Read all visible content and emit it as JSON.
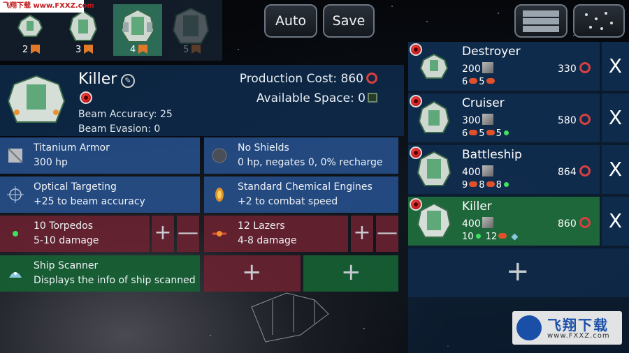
{
  "watermark": {
    "top_text": "飞翔下载 www.FXXZ.com",
    "bottom_cn": "飞翔下载",
    "bottom_url": "www.FXXZ.com"
  },
  "tray": {
    "slots": [
      {
        "num": "2"
      },
      {
        "num": "3"
      },
      {
        "num": "4"
      },
      {
        "num": "5"
      }
    ],
    "selected_index": 2
  },
  "toolbar": {
    "auto_label": "Auto",
    "save_label": "Save"
  },
  "ship": {
    "name": "Killer",
    "beam_accuracy": "Beam Accuracy: 25",
    "beam_evasion": "Beam Evasion: 0",
    "production_cost": "Production Cost: 860",
    "available_space": "Available Space: 0"
  },
  "modules": {
    "armor": {
      "title": "Titanium Armor",
      "desc": "300 hp"
    },
    "shields": {
      "title": "No Shields",
      "desc": "0 hp, negates 0, 0% recharge"
    },
    "targeting": {
      "title": "Optical Targeting",
      "desc": "+25 to beam accuracy"
    },
    "engines": {
      "title": "Standard Chemical Engines",
      "desc": "+2 to combat speed"
    },
    "torpedos": {
      "title": "10 Torpedos",
      "desc": "5-10 damage"
    },
    "lazers": {
      "title": "12 Lazers",
      "desc": "4-8 damage"
    },
    "scanner": {
      "title": "Ship Scanner",
      "desc": "Displays the info of ship scanned"
    }
  },
  "symbols": {
    "plus": "+",
    "minus": "—",
    "close": "X",
    "edit": "✎"
  },
  "designs": [
    {
      "name": "Destroyer",
      "hp": "200",
      "cost": "330",
      "w1": "6",
      "w2": "5",
      "w3": ""
    },
    {
      "name": "Cruiser",
      "hp": "300",
      "cost": "580",
      "w1": "6",
      "w2": "5",
      "w3": "5"
    },
    {
      "name": "Battleship",
      "hp": "400",
      "cost": "864",
      "w1": "9",
      "w2": "8",
      "w3": "8"
    },
    {
      "name": "Killer",
      "hp": "400",
      "cost": "860",
      "w1": "10",
      "w2": "12",
      "w3": ""
    }
  ],
  "selected_design": 3,
  "colors": {
    "panel_blue": "#2856a0",
    "weapon_red": "#6e2230",
    "selected_green": "#206e3c",
    "accent_orange": "#e07a28",
    "cost_red": "#d84040"
  }
}
